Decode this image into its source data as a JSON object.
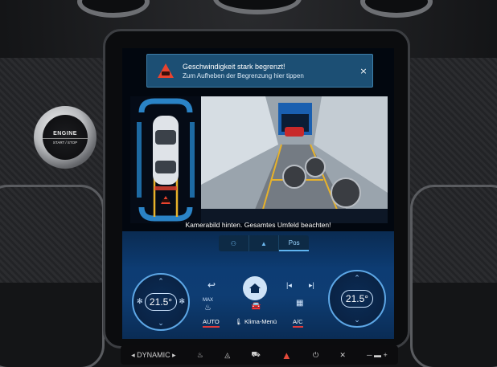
{
  "console": {
    "engine_button_line1": "ENGINE",
    "engine_button_line2": "START / STOP",
    "hardware_bar": {
      "drive_mode": "◂ DYNAMIC ▸",
      "icons": [
        "seat-heat-icon",
        "defrost-icon",
        "car-icon",
        "hazard-icon",
        "power-icon",
        "mute-icon",
        "volume-icon"
      ]
    }
  },
  "notification": {
    "title": "Geschwindigkeit stark begrenzt!",
    "subtitle": "Zum Aufheben der Begrenzung hier tippen",
    "close_symbol": "×",
    "warning_color": "#e8432f"
  },
  "camera": {
    "status_text": "Kamerabild hinten. Gesamtes Umfeld beachten!",
    "view_tabs": [
      {
        "label": "",
        "icon": "view-bird-icon"
      },
      {
        "label": "",
        "icon": "view-person-icon"
      },
      {
        "label": "Pos",
        "icon": ""
      }
    ],
    "active_tab": 2
  },
  "climate": {
    "left_temp": "21.5°",
    "right_temp": "21.5°",
    "back_symbol": "↩",
    "prev_symbol": "|◂",
    "next_symbol": "▸|",
    "max_label": "MAX",
    "auto_label": "AUTO",
    "klima_menu_label": "Klima-Menü",
    "ac_label": "A/C",
    "accent": "#5da7e6",
    "active_underline": "#e23a3a"
  }
}
